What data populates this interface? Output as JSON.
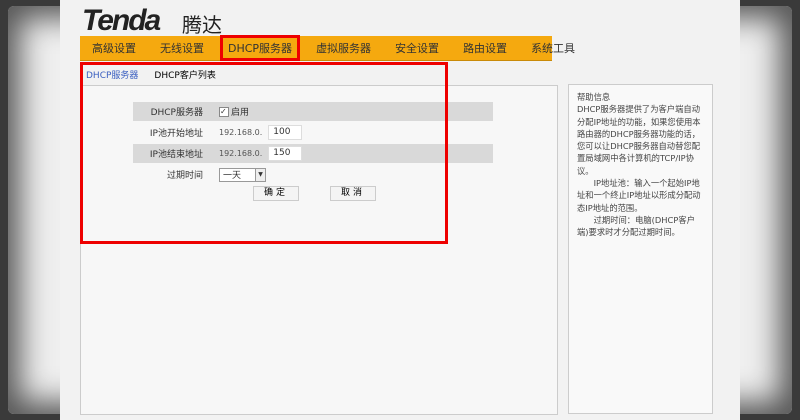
{
  "brand": {
    "logo": "Tenda",
    "logo_cn": "腾达"
  },
  "nav": [
    "高级设置",
    "无线设置",
    "DHCP服务器",
    "虚拟服务器",
    "安全设置",
    "路由设置",
    "系统工具"
  ],
  "nav_active": "DHCP服务器",
  "subnav": [
    "DHCP服务器",
    "DHCP客户列表"
  ],
  "form": {
    "dhcp_label": "DHCP服务器",
    "enable_check": "✓",
    "enable_label": "启用",
    "start_label": "IP池开始地址",
    "start_prefix": "192.168.0.",
    "start_value": "100",
    "end_label": "IP池结束地址",
    "end_prefix": "192.168.0.",
    "end_value": "150",
    "lease_label": "过期时间",
    "lease_value": "一天",
    "arrow": "▼",
    "ok": "确定",
    "cancel": "取消"
  },
  "help": {
    "title": "帮助信息",
    "p1": "DHCP服务器提供了为客户端自动分配IP地址的功能，如果您使用本路由器的DHCP服务器功能的话，您可以让DHCP服务器自动替您配置局域网中各计算机的TCP/IP协议。",
    "p2": "IP地址池：输入一个起始IP地址和一个终止IP地址以形成分配动态IP地址的范围。",
    "p3": "过期时间：电脑(DHCP客户端)要求时才分配过期时间。"
  }
}
